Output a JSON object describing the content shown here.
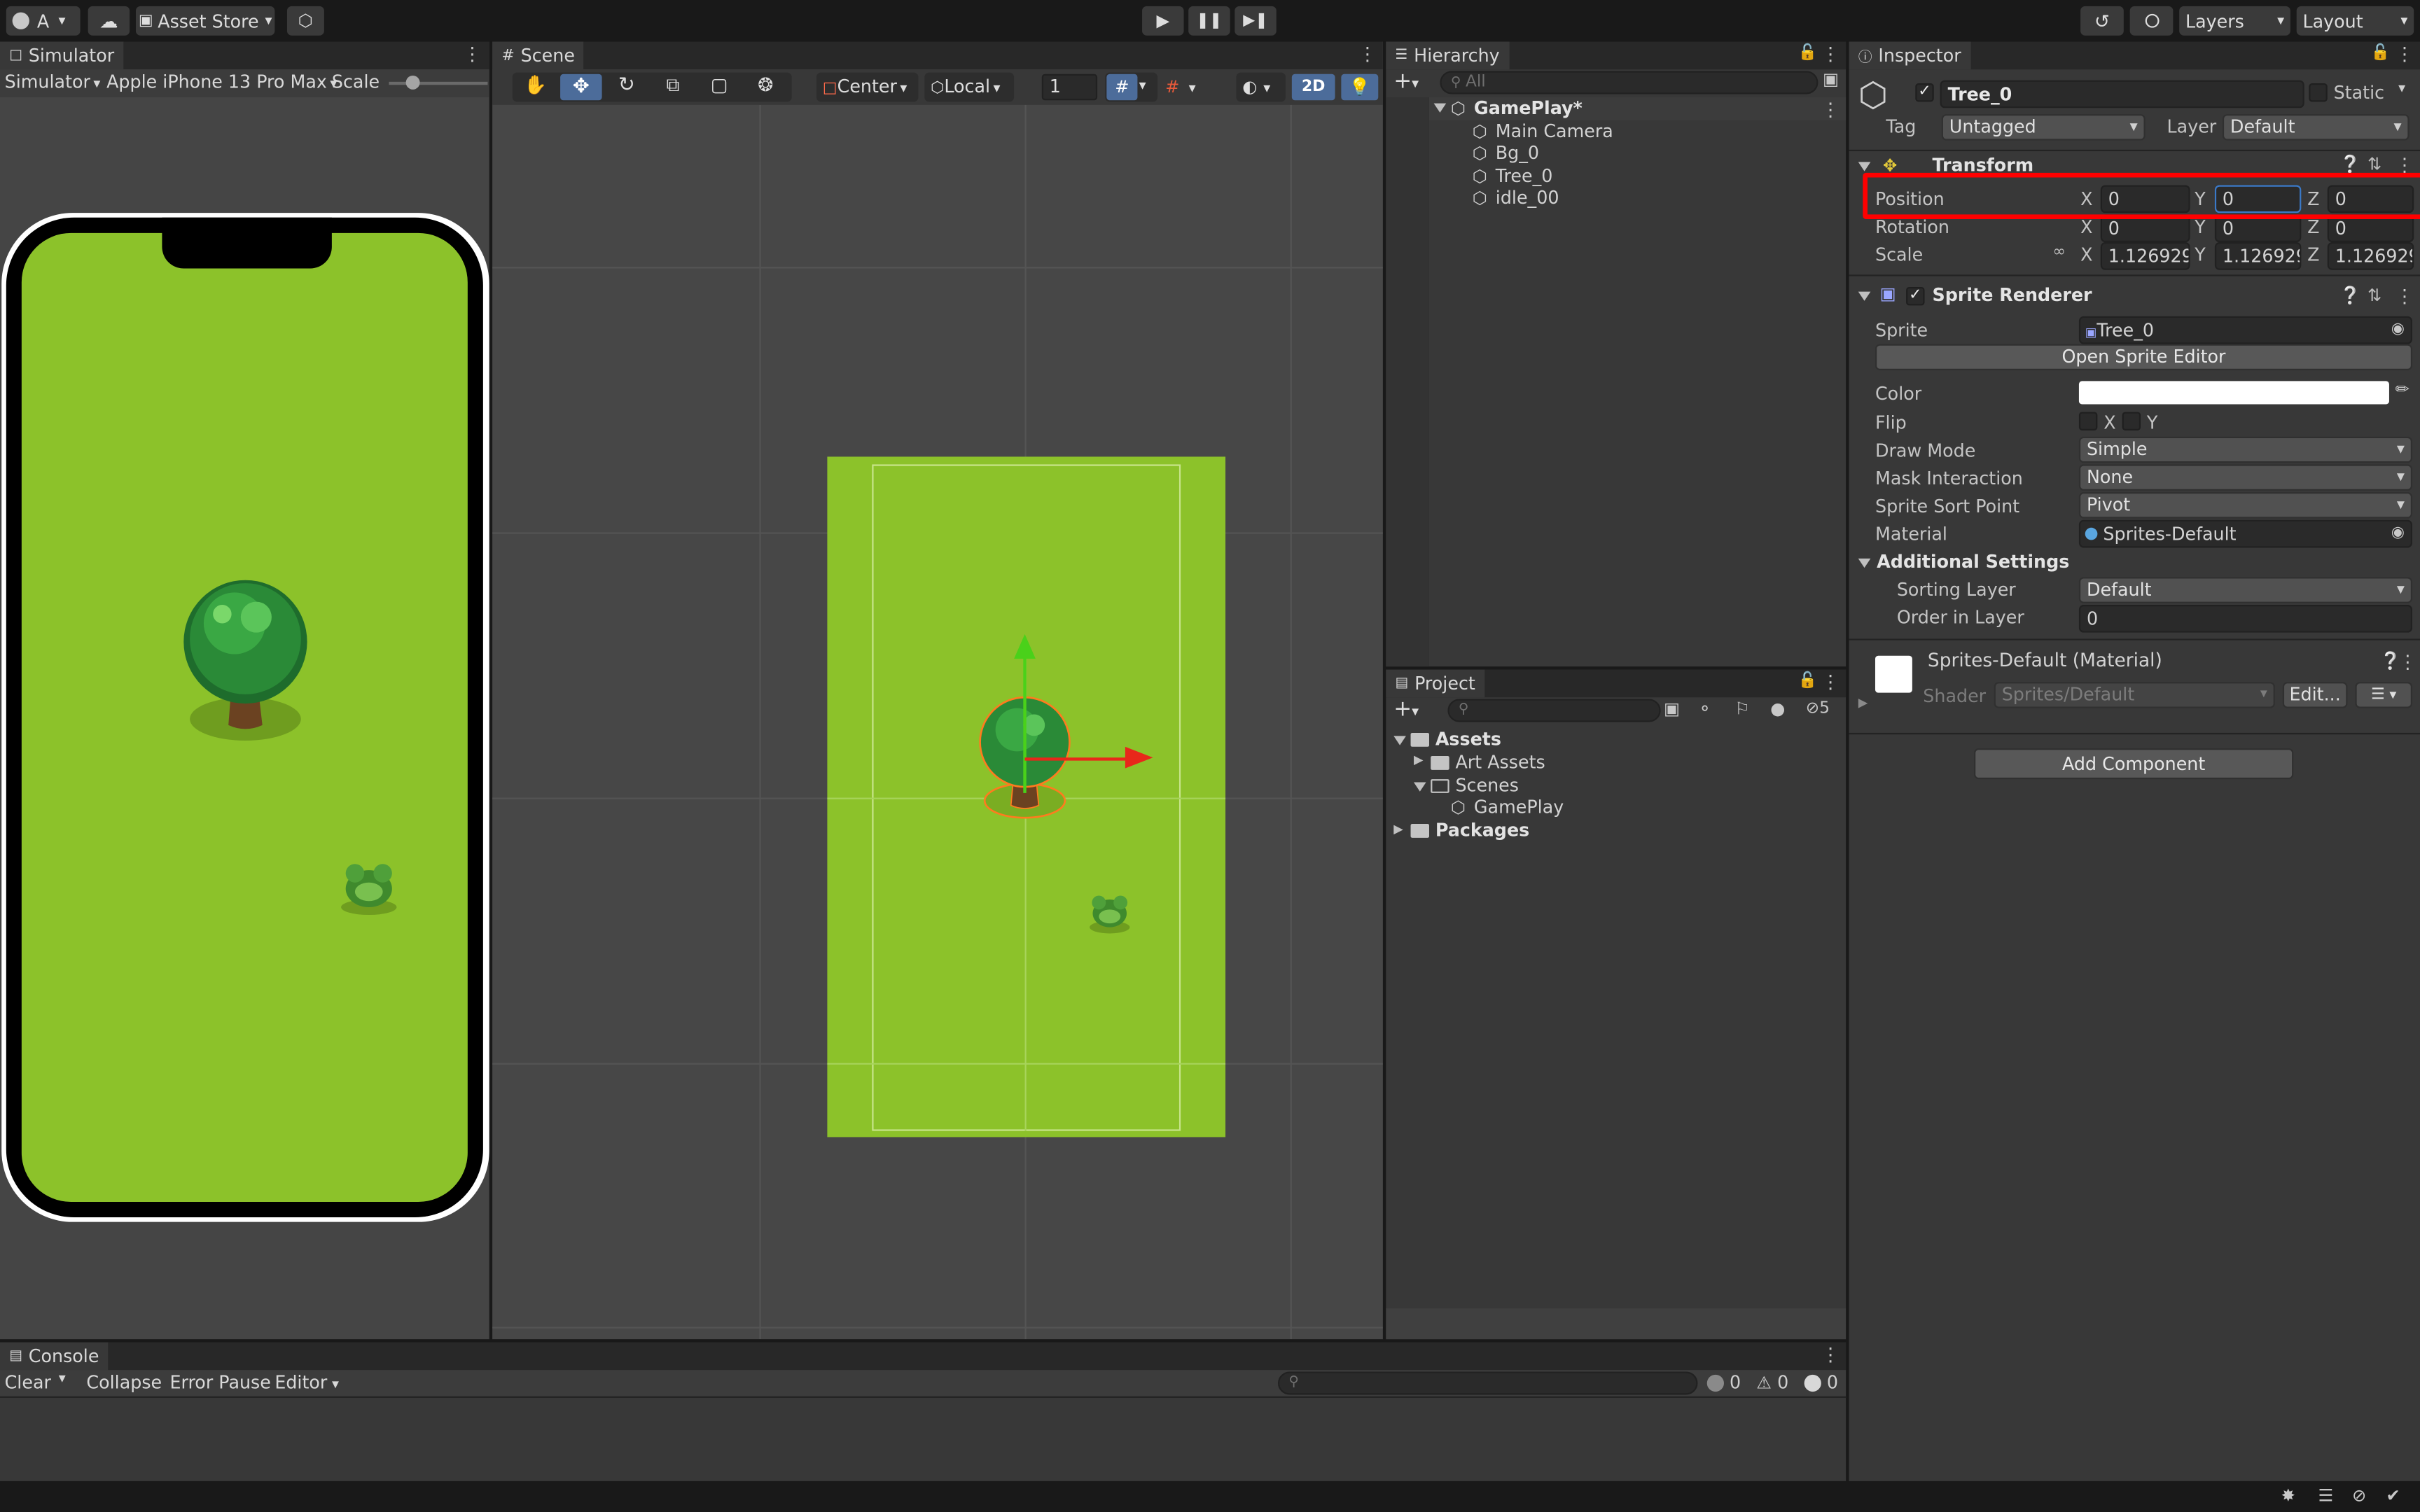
{
  "colors": {
    "grass": "#8cc22a",
    "accent_blue": "#4c6c9a",
    "highlight_red": "#ff0000",
    "axis_red": "#e8271a",
    "axis_green": "#4ad11a"
  },
  "toolbar": {
    "account_label": "A",
    "asset_store_label": "Asset Store",
    "layers_label": "Layers",
    "layout_label": "Layout"
  },
  "simulator": {
    "tab_label": "Simulator",
    "mode_select": "Simulator",
    "device_select": "Apple iPhone 13 Pro Max",
    "scale_label": "Scale"
  },
  "scene": {
    "tab_label": "Scene",
    "pivot_mode": "Center",
    "pivot_rotation": "Local",
    "grid_size": "1",
    "mode_2d": "2D"
  },
  "hierarchy": {
    "tab_label": "Hierarchy",
    "search_placeholder": "All",
    "scene_name": "GamePlay*",
    "items": [
      "Main Camera",
      "Bg_0",
      "Tree_0",
      "idle_00"
    ]
  },
  "project": {
    "tab_label": "Project",
    "hidden_count": "5",
    "assets_label": "Assets",
    "art_assets_label": "Art Assets",
    "scenes_label": "Scenes",
    "gameplay_label": "GamePlay",
    "packages_label": "Packages"
  },
  "inspector": {
    "tab_label": "Inspector",
    "object_name": "Tree_0",
    "static_label": "Static",
    "tag_label": "Tag",
    "tag_value": "Untagged",
    "layer_label": "Layer",
    "layer_value": "Default",
    "transform": {
      "title": "Transform",
      "position_label": "Position",
      "rotation_label": "Rotation",
      "scale_label": "Scale",
      "position": {
        "x": "0",
        "y": "0",
        "z": "0"
      },
      "rotation": {
        "x": "0",
        "y": "0",
        "z": "0"
      },
      "scale": {
        "x": "1.126929",
        "y": "1.126929",
        "z": "1.126929"
      }
    },
    "sprite_renderer": {
      "title": "Sprite Renderer",
      "sprite_label": "Sprite",
      "sprite_value": "Tree_0",
      "open_editor_label": "Open Sprite Editor",
      "color_label": "Color",
      "flip_label": "Flip",
      "flip_x": "X",
      "flip_y": "Y",
      "draw_mode_label": "Draw Mode",
      "draw_mode_value": "Simple",
      "mask_label": "Mask Interaction",
      "mask_value": "None",
      "sort_point_label": "Sprite Sort Point",
      "sort_point_value": "Pivot",
      "material_label": "Material",
      "material_value": "Sprites-Default",
      "additional_label": "Additional Settings",
      "sorting_layer_label": "Sorting Layer",
      "sorting_layer_value": "Default",
      "order_label": "Order in Layer",
      "order_value": "0"
    },
    "material": {
      "title": "Sprites-Default (Material)",
      "shader_label": "Shader",
      "shader_value": "Sprites/Default",
      "edit_label": "Edit..."
    },
    "add_component_label": "Add Component"
  },
  "console": {
    "tab_label": "Console",
    "clear_label": "Clear",
    "collapse_label": "Collapse",
    "error_pause_label": "Error Pause",
    "editor_label": "Editor",
    "log_count": "0",
    "warn_count": "0",
    "error_count": "0"
  }
}
